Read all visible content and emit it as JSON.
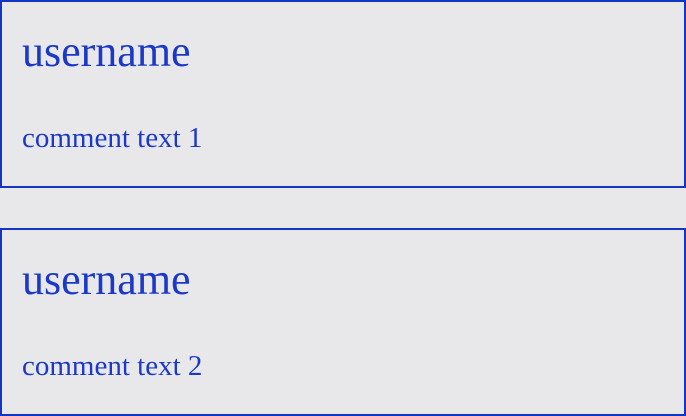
{
  "colors": {
    "background": "#e8e7ea",
    "border": "#1335c4",
    "text": "#1a39c8"
  },
  "comments": [
    {
      "username": "username",
      "text": "comment text 1"
    },
    {
      "username": "username",
      "text": "comment text 2"
    }
  ]
}
